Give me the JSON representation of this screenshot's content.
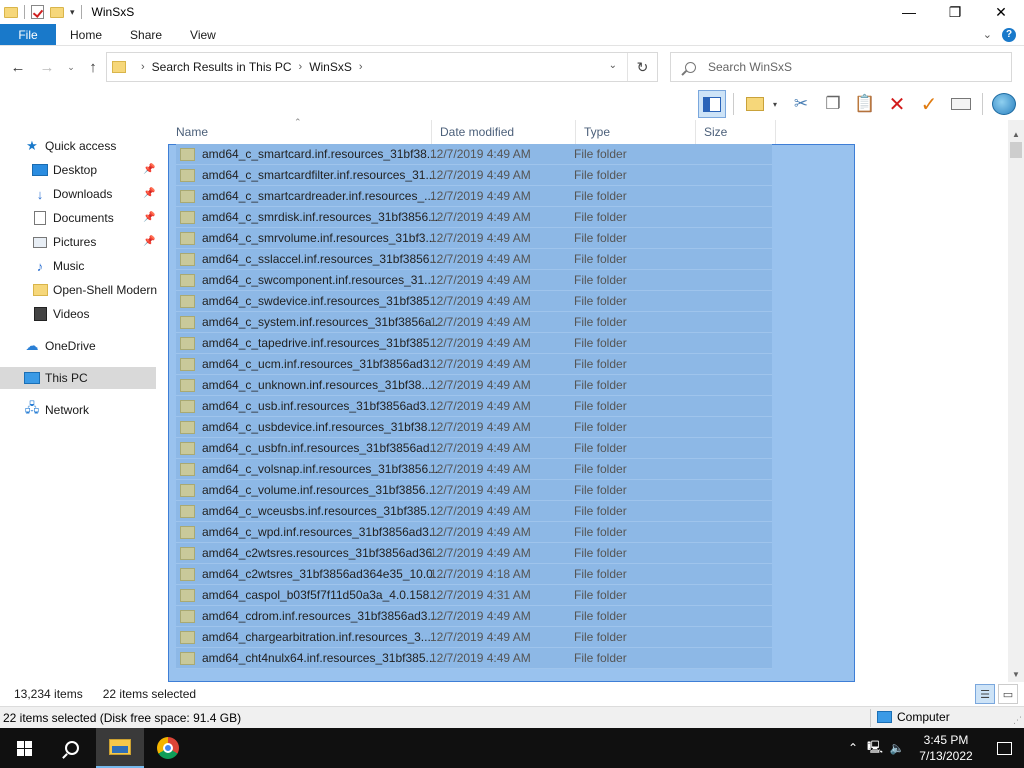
{
  "window": {
    "title": "WinSxS",
    "minimize_glyph": "—",
    "maximize_glyph": "❐",
    "close_glyph": "✕"
  },
  "ribbon": {
    "tabs": [
      "File",
      "Home",
      "Share",
      "View"
    ],
    "expand_glyph": "⌄",
    "help_glyph": "?"
  },
  "address": {
    "crumbs": [
      "Search Results in This PC",
      "WinSxS"
    ],
    "separator": "›"
  },
  "search": {
    "placeholder": "Search WinSxS"
  },
  "toolbar": {
    "icons": [
      "navigation-pane-icon",
      "properties-icon",
      "cut-icon",
      "copy-icon",
      "paste-icon",
      "delete-icon",
      "undo-icon",
      "rename-icon",
      "internet-icon"
    ]
  },
  "sidebar": {
    "items": [
      {
        "label": "Quick access",
        "icon": "star-icon"
      },
      {
        "label": "Desktop",
        "icon": "desktop-icon",
        "pinned": true
      },
      {
        "label": "Downloads",
        "icon": "downloads-icon",
        "pinned": true
      },
      {
        "label": "Documents",
        "icon": "documents-icon",
        "pinned": true
      },
      {
        "label": "Pictures",
        "icon": "pictures-icon",
        "pinned": true
      },
      {
        "label": "Music",
        "icon": "music-icon"
      },
      {
        "label": "Open-Shell Modern",
        "icon": "folder-icon"
      },
      {
        "label": "Videos",
        "icon": "videos-icon"
      },
      {
        "label": "OneDrive",
        "icon": "onedrive-icon"
      },
      {
        "label": "This PC",
        "icon": "this-pc-icon",
        "selected": true
      },
      {
        "label": "Network",
        "icon": "network-icon"
      }
    ]
  },
  "columns": {
    "name": "Name",
    "date": "Date modified",
    "type": "Type",
    "size": "Size"
  },
  "files": [
    {
      "name": "amd64_c_smartcard.inf.resources_31bf38...",
      "date": "12/7/2019 4:49 AM",
      "type": "File folder"
    },
    {
      "name": "amd64_c_smartcardfilter.inf.resources_31...",
      "date": "12/7/2019 4:49 AM",
      "type": "File folder"
    },
    {
      "name": "amd64_c_smartcardreader.inf.resources_...",
      "date": "12/7/2019 4:49 AM",
      "type": "File folder"
    },
    {
      "name": "amd64_c_smrdisk.inf.resources_31bf3856...",
      "date": "12/7/2019 4:49 AM",
      "type": "File folder"
    },
    {
      "name": "amd64_c_smrvolume.inf.resources_31bf3...",
      "date": "12/7/2019 4:49 AM",
      "type": "File folder"
    },
    {
      "name": "amd64_c_sslaccel.inf.resources_31bf3856...",
      "date": "12/7/2019 4:49 AM",
      "type": "File folder"
    },
    {
      "name": "amd64_c_swcomponent.inf.resources_31...",
      "date": "12/7/2019 4:49 AM",
      "type": "File folder"
    },
    {
      "name": "amd64_c_swdevice.inf.resources_31bf385...",
      "date": "12/7/2019 4:49 AM",
      "type": "File folder"
    },
    {
      "name": "amd64_c_system.inf.resources_31bf3856a...",
      "date": "12/7/2019 4:49 AM",
      "type": "File folder"
    },
    {
      "name": "amd64_c_tapedrive.inf.resources_31bf385...",
      "date": "12/7/2019 4:49 AM",
      "type": "File folder"
    },
    {
      "name": "amd64_c_ucm.inf.resources_31bf3856ad3...",
      "date": "12/7/2019 4:49 AM",
      "type": "File folder"
    },
    {
      "name": "amd64_c_unknown.inf.resources_31bf38...",
      "date": "12/7/2019 4:49 AM",
      "type": "File folder"
    },
    {
      "name": "amd64_c_usb.inf.resources_31bf3856ad3...",
      "date": "12/7/2019 4:49 AM",
      "type": "File folder"
    },
    {
      "name": "amd64_c_usbdevice.inf.resources_31bf38...",
      "date": "12/7/2019 4:49 AM",
      "type": "File folder"
    },
    {
      "name": "amd64_c_usbfn.inf.resources_31bf3856ad...",
      "date": "12/7/2019 4:49 AM",
      "type": "File folder"
    },
    {
      "name": "amd64_c_volsnap.inf.resources_31bf3856...",
      "date": "12/7/2019 4:49 AM",
      "type": "File folder"
    },
    {
      "name": "amd64_c_volume.inf.resources_31bf3856...",
      "date": "12/7/2019 4:49 AM",
      "type": "File folder"
    },
    {
      "name": "amd64_c_wceusbs.inf.resources_31bf385...",
      "date": "12/7/2019 4:49 AM",
      "type": "File folder"
    },
    {
      "name": "amd64_c_wpd.inf.resources_31bf3856ad3...",
      "date": "12/7/2019 4:49 AM",
      "type": "File folder"
    },
    {
      "name": "amd64_c2wtsres.resources_31bf3856ad36...",
      "date": "12/7/2019 4:49 AM",
      "type": "File folder"
    },
    {
      "name": "amd64_c2wtsres_31bf3856ad364e35_10.0....",
      "date": "12/7/2019 4:18 AM",
      "type": "File folder"
    },
    {
      "name": "amd64_caspol_b03f5f7f11d50a3a_4.0.158...",
      "date": "12/7/2019 4:31 AM",
      "type": "File folder"
    },
    {
      "name": "amd64_cdrom.inf.resources_31bf3856ad3...",
      "date": "12/7/2019 4:49 AM",
      "type": "File folder"
    },
    {
      "name": "amd64_chargearbitration.inf.resources_3...",
      "date": "12/7/2019 4:49 AM",
      "type": "File folder"
    },
    {
      "name": "amd64_cht4nulx64.inf.resources_31bf385...",
      "date": "12/7/2019 4:49 AM",
      "type": "File folder"
    }
  ],
  "status": {
    "item_count": "13,234 items",
    "selected_count": "22 items selected"
  },
  "classic_status": {
    "text": "22 items selected (Disk free space: 91.4 GB)",
    "location": "Computer"
  },
  "taskbar": {
    "time": "3:45 PM",
    "date": "7/13/2022",
    "tray_icons": [
      "chevron-up-icon",
      "network-tray-icon",
      "volume-icon"
    ]
  }
}
